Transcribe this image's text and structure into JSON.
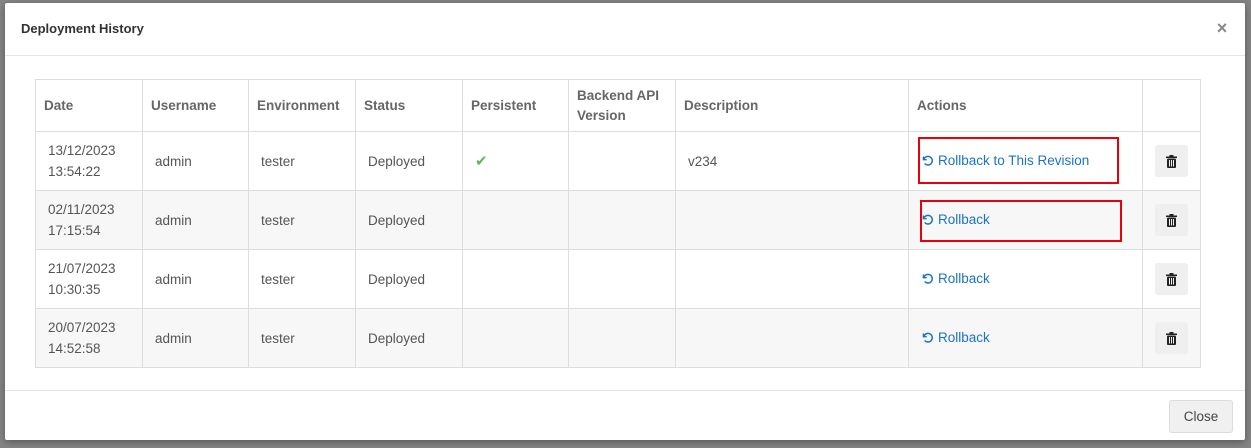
{
  "modal": {
    "title": "Deployment History",
    "close_icon": "×",
    "footer_close_label": "Close"
  },
  "table": {
    "headers": [
      "Date",
      "Username",
      "Environment",
      "Status",
      "Persistent",
      "Backend API Version",
      "Description",
      "Actions",
      ""
    ],
    "rows": [
      {
        "date": "13/12/2023",
        "time": "13:54:22",
        "username": "admin",
        "environment": "tester",
        "status": "Deployed",
        "persistent": "✔",
        "backend_api_version": "",
        "description": "v234",
        "action_label": "Rollback to This Revision"
      },
      {
        "date": "02/11/2023",
        "time": "17:15:54",
        "username": "admin",
        "environment": "tester",
        "status": "Deployed",
        "persistent": "",
        "backend_api_version": "",
        "description": "",
        "action_label": "Rollback"
      },
      {
        "date": "21/07/2023",
        "time": "10:30:35",
        "username": "admin",
        "environment": "tester",
        "status": "Deployed",
        "persistent": "",
        "backend_api_version": "",
        "description": "",
        "action_label": "Rollback"
      },
      {
        "date": "20/07/2023",
        "time": "14:52:58",
        "username": "admin",
        "environment": "tester",
        "status": "Deployed",
        "persistent": "",
        "backend_api_version": "",
        "description": "",
        "action_label": "Rollback"
      }
    ]
  },
  "colors": {
    "link": "#1a73c8",
    "highlight_border": "#e8000b",
    "check": "#5cb85c"
  },
  "icons": {
    "rollback": "undo-icon",
    "delete": "trash-icon",
    "persistent": "checkmark-icon"
  }
}
